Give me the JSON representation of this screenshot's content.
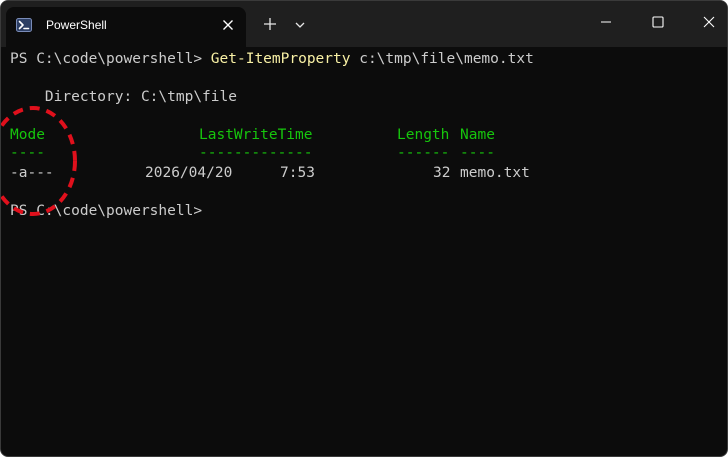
{
  "tab": {
    "title": "PowerShell",
    "icon": "powershell-icon",
    "close_icon": "close-icon"
  },
  "titlebar": {
    "new_tab_icon": "plus-icon",
    "dropdown_icon": "chevron-down-icon",
    "minimize_icon": "minimize-icon",
    "maximize_icon": "maximize-icon",
    "close_icon": "close-icon"
  },
  "terminal": {
    "prompt1": "PS C:\\code\\powershell> ",
    "command": "Get-ItemProperty",
    "argument": " c:\\tmp\\file\\memo.txt",
    "directory_line": "    Directory: C:\\tmp\\file",
    "table": {
      "headers": {
        "mode": "Mode",
        "lastwritetime": "LastWriteTime",
        "length": "Length",
        "name": "Name"
      },
      "underlines": {
        "mode": "----",
        "lastwritetime": "-------------",
        "length": "------",
        "name": "----"
      },
      "rows": [
        {
          "mode": "-a---",
          "date": "2026/04/20",
          "time": "7:53",
          "length": "32",
          "name": "memo.txt"
        }
      ]
    },
    "prompt2": "PS C:\\code\\powershell>"
  },
  "colors": {
    "background": "#0c0c0c",
    "titlebar": "#1f1f1f",
    "text": "#cccccc",
    "command": "#f9f1a5",
    "header": "#16c60c",
    "annotation": "#e0101c"
  }
}
